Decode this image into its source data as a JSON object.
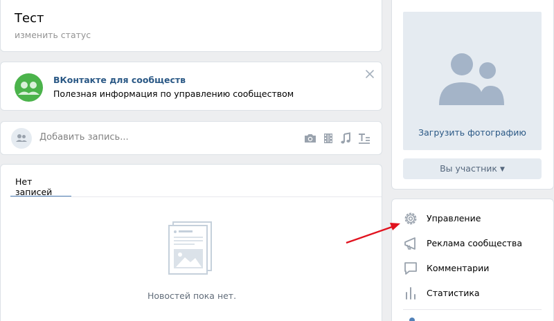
{
  "header": {
    "page_name": "Тест",
    "status_link": "изменить статус"
  },
  "promo": {
    "title": "ВКонтакте для сообществ",
    "text": "Полезная информация по управлению сообществом",
    "logo_icon": "vk-communities-logo-icon",
    "close_icon": "close-icon"
  },
  "composer": {
    "placeholder": "Добавить запись...",
    "attach_icons": [
      "camera-icon",
      "video-film-icon",
      "music-note-icon",
      "text-format-icon"
    ]
  },
  "wall": {
    "tab_label": "Нет записей",
    "empty_text": "Новостей пока нет."
  },
  "sidebar": {
    "upload_photo": "Загрузить фотографию",
    "member_button": "Вы участник",
    "menu": [
      {
        "label": "Управление",
        "icon": "gear-icon"
      },
      {
        "label": "Реклама сообщества",
        "icon": "megaphone-icon"
      },
      {
        "label": "Комментарии",
        "icon": "comment-icon"
      },
      {
        "label": "Статистика",
        "icon": "statistics-icon"
      }
    ]
  },
  "colors": {
    "link": "#2a5885",
    "accent": "#5181b8",
    "icon": "#99a2ad",
    "annotation_arrow": "#e1131f"
  }
}
